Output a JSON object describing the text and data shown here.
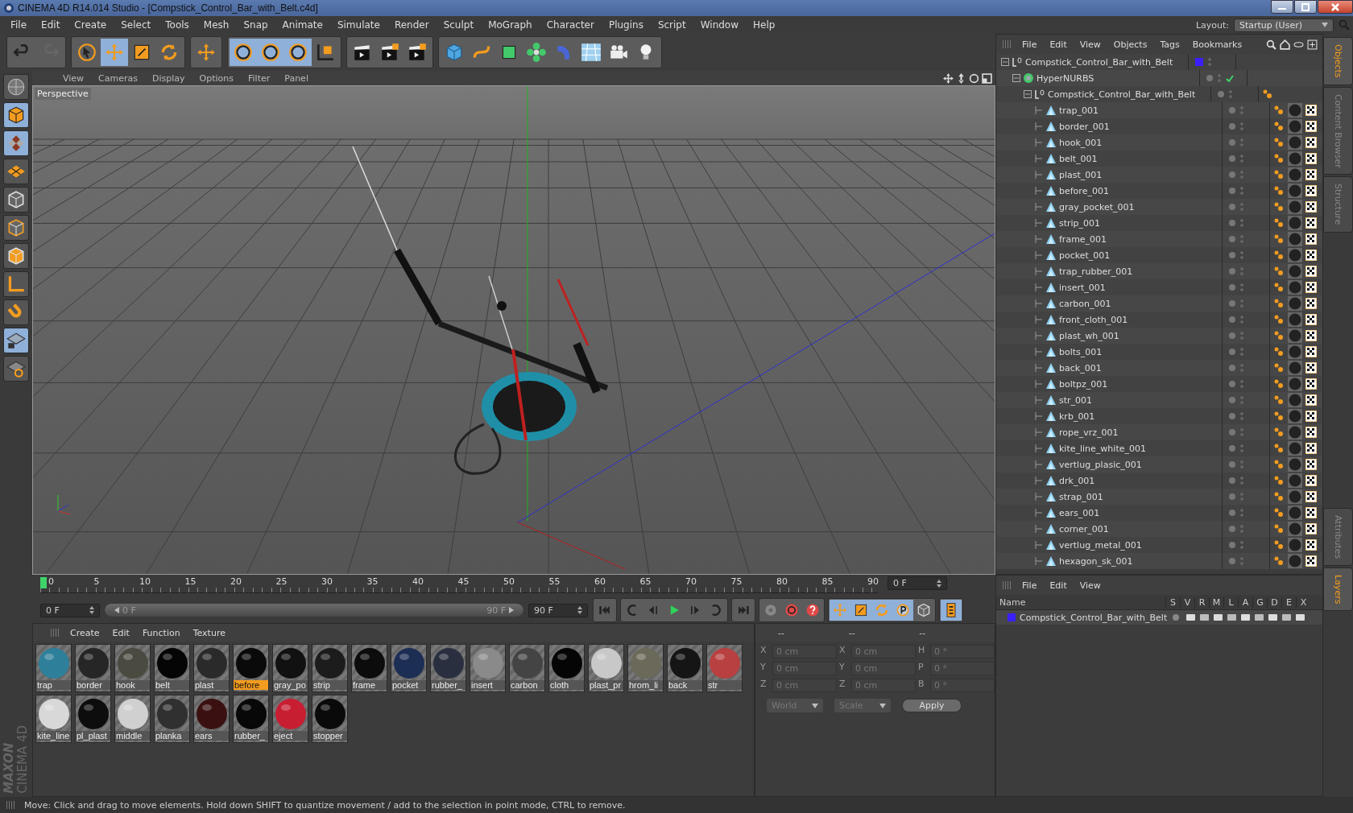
{
  "window": {
    "title": "CINEMA 4D R14.014 Studio - [Compstick_Control_Bar_with_Belt.c4d]"
  },
  "menu": [
    "File",
    "Edit",
    "Create",
    "Select",
    "Tools",
    "Mesh",
    "Snap",
    "Animate",
    "Simulate",
    "Render",
    "Sculpt",
    "MoGraph",
    "Character",
    "Plugins",
    "Script",
    "Window",
    "Help"
  ],
  "layout": {
    "label": "Layout:",
    "value": "Startup (User)"
  },
  "toolbar": [
    [
      {
        "kind": "undo",
        "selected": false
      },
      {
        "kind": "redo",
        "selected": false
      }
    ],
    [
      {
        "kind": "select",
        "selected": false
      },
      {
        "kind": "move",
        "selected": true
      },
      {
        "kind": "scale",
        "selected": false
      },
      {
        "kind": "rotate",
        "selected": false
      }
    ],
    [
      {
        "kind": "add",
        "selected": false
      }
    ],
    [
      {
        "kind": "axis-x",
        "selected": true
      },
      {
        "kind": "axis-y",
        "selected": true
      },
      {
        "kind": "axis-z",
        "selected": true
      },
      {
        "kind": "coords",
        "selected": false
      }
    ],
    [
      {
        "kind": "render-view",
        "selected": false
      },
      {
        "kind": "render-picture",
        "selected": false
      },
      {
        "kind": "render-settings",
        "selected": false
      }
    ],
    [
      {
        "kind": "cube",
        "selected": false
      },
      {
        "kind": "spline",
        "selected": false
      },
      {
        "kind": "subdivide",
        "selected": false
      },
      {
        "kind": "cloner",
        "selected": false
      },
      {
        "kind": "deformer",
        "selected": false
      },
      {
        "kind": "floor",
        "selected": false
      },
      {
        "kind": "camera",
        "selected": false
      },
      {
        "kind": "light",
        "selected": false
      }
    ]
  ],
  "left_tools": [
    {
      "kind": "sphere",
      "selected": false
    },
    {
      "kind": "model",
      "selected": true
    },
    {
      "kind": "checker",
      "selected": true
    },
    {
      "kind": "grid",
      "selected": false
    },
    {
      "kind": "points",
      "selected": false
    },
    {
      "kind": "edges",
      "selected": false
    },
    {
      "kind": "polygons",
      "selected": false
    },
    {
      "kind": "axis",
      "selected": false
    },
    {
      "kind": "magnet",
      "selected": false
    },
    {
      "kind": "workplane",
      "selected": true
    },
    {
      "kind": "snap",
      "selected": false
    }
  ],
  "logo": {
    "brand": "MAXON",
    "product": "CINEMA 4D"
  },
  "viewport": {
    "menu": [
      "View",
      "Cameras",
      "Display",
      "Options",
      "Filter",
      "Panel"
    ],
    "camera": "Perspective"
  },
  "timeline": {
    "ticks": [
      "0",
      "5",
      "10",
      "15",
      "20",
      "25",
      "30",
      "35",
      "40",
      "45",
      "50",
      "55",
      "60",
      "65",
      "70",
      "75",
      "80",
      "85",
      "90"
    ],
    "frame": "0 F",
    "level": 0
  },
  "transport": {
    "start": "0 F",
    "range_start": "0 F",
    "range_end": "90 F",
    "end": "90 F",
    "level": 1,
    "buttons": [
      {
        "kind": "first",
        "selected": false
      },
      {
        "kind": "loop-left",
        "selected": false
      },
      {
        "kind": "step-back",
        "selected": false
      },
      {
        "kind": "play",
        "selected": false
      },
      {
        "kind": "step-forward",
        "selected": false
      },
      {
        "kind": "loop-right",
        "selected": false
      },
      {
        "kind": "last",
        "selected": false
      },
      {
        "kind": "record",
        "selected": false
      },
      {
        "kind": "autokey",
        "selected": false
      },
      {
        "kind": "help",
        "selected": false
      },
      {
        "kind": "move",
        "selected": true
      },
      {
        "kind": "scale",
        "selected": true
      },
      {
        "kind": "rotate",
        "selected": true
      },
      {
        "kind": "param",
        "selected": true
      },
      {
        "kind": "points",
        "selected": false
      },
      {
        "kind": "film",
        "selected": true
      }
    ]
  },
  "materials": {
    "menu": [
      "Create",
      "Edit",
      "Function",
      "Texture"
    ],
    "items": [
      {
        "name": "trap",
        "selected": false,
        "color": "#2e7f9a"
      },
      {
        "name": "border",
        "selected": false,
        "color": "#262626"
      },
      {
        "name": "hook",
        "selected": false,
        "color": "#4a4a40"
      },
      {
        "name": "belt",
        "selected": false,
        "color": "#050505"
      },
      {
        "name": "plast",
        "selected": false,
        "color": "#2a2a2a"
      },
      {
        "name": "before",
        "selected": true,
        "color": "#0a0a0a"
      },
      {
        "name": "gray_po",
        "selected": false,
        "color": "#111111"
      },
      {
        "name": "strip",
        "selected": false,
        "color": "#1c1c1c"
      },
      {
        "name": "frame",
        "selected": false,
        "color": "#0c0c0c"
      },
      {
        "name": "pocket",
        "selected": false,
        "color": "#1d2e55"
      },
      {
        "name": "rubber_",
        "selected": false,
        "color": "#2a2f40"
      },
      {
        "name": "insert",
        "selected": false,
        "color": "#8a8a8a"
      },
      {
        "name": "carbon",
        "selected": false,
        "color": "#444444"
      },
      {
        "name": "cloth",
        "selected": false,
        "color": "#050505"
      },
      {
        "name": "plast_pr",
        "selected": false,
        "color": "#c8c8c8"
      },
      {
        "name": "hrom_li",
        "selected": false,
        "color": "#6b6a5a"
      },
      {
        "name": "back",
        "selected": false,
        "color": "#151515"
      },
      {
        "name": "str",
        "selected": false,
        "color": "#b84040"
      },
      {
        "name": "kite_line",
        "selected": false,
        "color": "#d8d8d8"
      },
      {
        "name": "pl_plast",
        "selected": false,
        "color": "#0d0d0d"
      },
      {
        "name": "middle",
        "selected": false,
        "color": "#d0d0d0"
      },
      {
        "name": "planka",
        "selected": false,
        "color": "#303030"
      },
      {
        "name": "ears",
        "selected": false,
        "color": "#3a1010"
      },
      {
        "name": "rubber_",
        "selected": false,
        "color": "#080808"
      },
      {
        "name": "eject",
        "selected": false,
        "color": "#c81e32"
      },
      {
        "name": "stopper",
        "selected": false,
        "color": "#0a0a0a"
      }
    ]
  },
  "coordinates": {
    "headers": [
      "--",
      "--",
      "--"
    ],
    "rows": [
      [
        {
          "label": "X",
          "placeholder": "0 cm"
        },
        {
          "label": "X",
          "placeholder": "0 cm"
        },
        {
          "label": "H",
          "placeholder": "0 °"
        }
      ],
      [
        {
          "label": "Y",
          "placeholder": "0 cm"
        },
        {
          "label": "Y",
          "placeholder": "0 cm"
        },
        {
          "label": "P",
          "placeholder": "0 °"
        }
      ],
      [
        {
          "label": "Z",
          "placeholder": "0 cm"
        },
        {
          "label": "Z",
          "placeholder": "0 cm"
        },
        {
          "label": "B",
          "placeholder": "0 °"
        }
      ]
    ],
    "space": "World",
    "mode": "Scale",
    "apply": "Apply"
  },
  "objects": {
    "menu": [
      "File",
      "Edit",
      "View",
      "Objects",
      "Tags",
      "Bookmarks"
    ],
    "tree": [
      {
        "name": "Compstick_Control_Bar_with_Belt",
        "kind": "null",
        "color": "#3a1fff",
        "children": [
          {
            "name": "HyperNURBS",
            "kind": "hypernurbs",
            "checked": true,
            "children": [
              {
                "name": "Compstick_Control_Bar_with_Belt",
                "kind": "null",
                "children": [
                  {
                    "name": "trap_001",
                    "kind": "polygon"
                  },
                  {
                    "name": "border_001",
                    "kind": "polygon"
                  },
                  {
                    "name": "hook_001",
                    "kind": "polygon"
                  },
                  {
                    "name": "belt_001",
                    "kind": "polygon"
                  },
                  {
                    "name": "plast_001",
                    "kind": "polygon"
                  },
                  {
                    "name": "before_001",
                    "kind": "polygon"
                  },
                  {
                    "name": "gray_pocket_001",
                    "kind": "polygon"
                  },
                  {
                    "name": "strip_001",
                    "kind": "polygon"
                  },
                  {
                    "name": "frame_001",
                    "kind": "polygon"
                  },
                  {
                    "name": "pocket_001",
                    "kind": "polygon"
                  },
                  {
                    "name": "trap_rubber_001",
                    "kind": "polygon"
                  },
                  {
                    "name": "insert_001",
                    "kind": "polygon"
                  },
                  {
                    "name": "carbon_001",
                    "kind": "polygon"
                  },
                  {
                    "name": "front_cloth_001",
                    "kind": "polygon"
                  },
                  {
                    "name": "plast_wh_001",
                    "kind": "polygon"
                  },
                  {
                    "name": "bolts_001",
                    "kind": "polygon"
                  },
                  {
                    "name": "back_001",
                    "kind": "polygon"
                  },
                  {
                    "name": "boltpz_001",
                    "kind": "polygon"
                  },
                  {
                    "name": "str_001",
                    "kind": "polygon"
                  },
                  {
                    "name": "krb_001",
                    "kind": "polygon"
                  },
                  {
                    "name": "rope_vrz_001",
                    "kind": "polygon"
                  },
                  {
                    "name": "kite_line_white_001",
                    "kind": "polygon"
                  },
                  {
                    "name": "vertlug_plasic_001",
                    "kind": "polygon"
                  },
                  {
                    "name": "drk_001",
                    "kind": "polygon"
                  },
                  {
                    "name": "strap_001",
                    "kind": "polygon"
                  },
                  {
                    "name": "ears_001",
                    "kind": "polygon"
                  },
                  {
                    "name": "corner_001",
                    "kind": "polygon"
                  },
                  {
                    "name": "vertlug_metal_001",
                    "kind": "polygon"
                  },
                  {
                    "name": "hexagon_sk_001",
                    "kind": "polygon"
                  }
                ]
              }
            ]
          }
        ]
      }
    ]
  },
  "side_tabs_top": [
    {
      "label": "Objects",
      "selected": true
    },
    {
      "label": "Content Browser",
      "selected": false
    },
    {
      "label": "Structure",
      "selected": false
    }
  ],
  "layers": {
    "menu": [
      "File",
      "Edit",
      "View"
    ],
    "columns": [
      "Name",
      "S",
      "V",
      "R",
      "M",
      "L",
      "A",
      "G",
      "D",
      "E",
      "X"
    ],
    "rows": [
      {
        "name": "Compstick_Control_Bar_with_Belt",
        "color": "#3a1fff"
      }
    ]
  },
  "side_tabs_bottom": [
    {
      "label": "Attributes",
      "selected": false
    },
    {
      "label": "Layers",
      "selected": true
    }
  ],
  "status_bar": "Move: Click and drag to move elements. Hold down SHIFT to quantize movement / add to the selection in point mode, CTRL to remove."
}
